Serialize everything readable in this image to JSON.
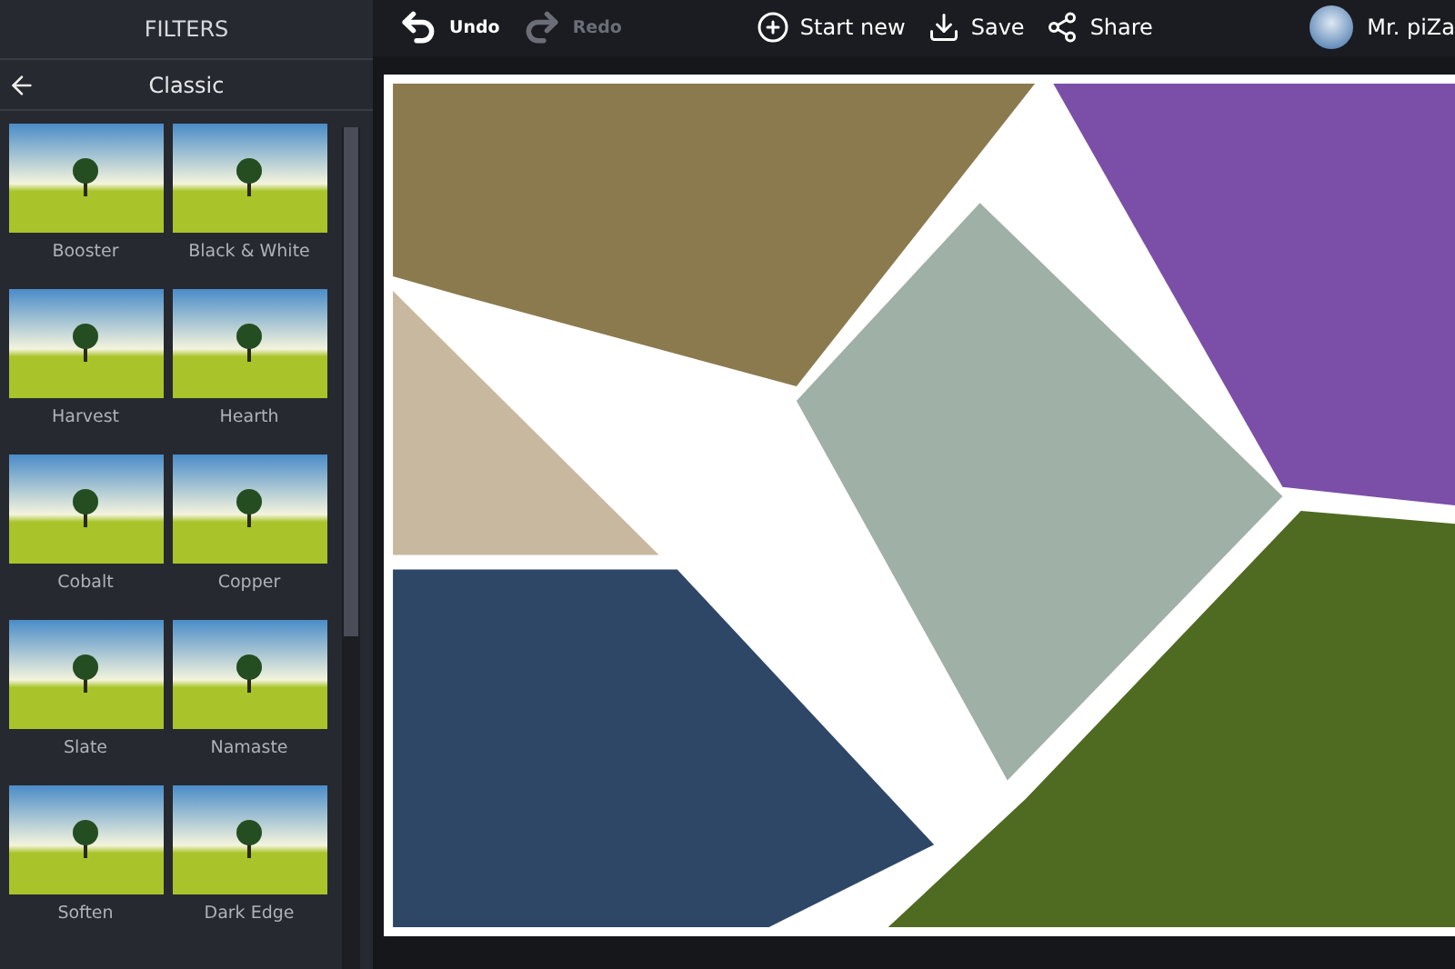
{
  "sidebar": {
    "title": "FILTERS",
    "category": "Classic",
    "filters": [
      {
        "label": "Booster"
      },
      {
        "label": "Black & White"
      },
      {
        "label": "Harvest"
      },
      {
        "label": "Hearth"
      },
      {
        "label": "Cobalt"
      },
      {
        "label": "Copper"
      },
      {
        "label": "Slate"
      },
      {
        "label": "Namaste"
      },
      {
        "label": "Soften"
      },
      {
        "label": "Dark Edge"
      }
    ]
  },
  "toolbar": {
    "undo": {
      "label": "Undo",
      "disabled": false
    },
    "redo": {
      "label": "Redo",
      "disabled": true
    },
    "actions": [
      {
        "kind": "add",
        "label": "Start new"
      },
      {
        "kind": "save",
        "label": "Save"
      },
      {
        "kind": "share",
        "label": "Share"
      }
    ],
    "user": "Mr. piZa"
  }
}
